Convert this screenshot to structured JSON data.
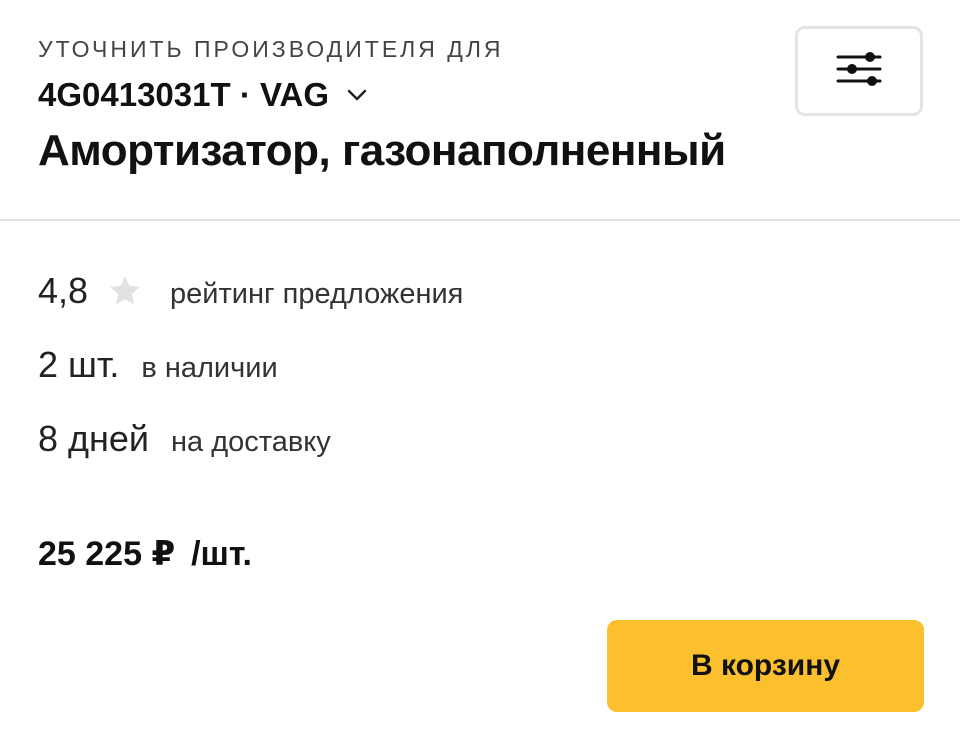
{
  "header": {
    "subtitle": "УТОЧНИТЬ ПРОИЗВОДИТЕЛЯ ДЛЯ",
    "part_number": "4G0413031T · VAG",
    "title": "Амортизатор, газонаполненный",
    "filter_icon": "sliders-icon",
    "dropdown_icon": "chevron-down-icon"
  },
  "stats": {
    "rating_value": "4,8",
    "rating_label": "рейтинг предложения",
    "star_icon": "star-icon",
    "star_color": "#e2e2e2",
    "stock_value": "2 шт.",
    "stock_label": "в наличии",
    "delivery_value": "8 дней",
    "delivery_label": "на доставку"
  },
  "price": {
    "amount": "25 225 ₽",
    "unit": "/шт."
  },
  "cart_button": {
    "label": "В корзину",
    "color": "#fcc02e"
  }
}
